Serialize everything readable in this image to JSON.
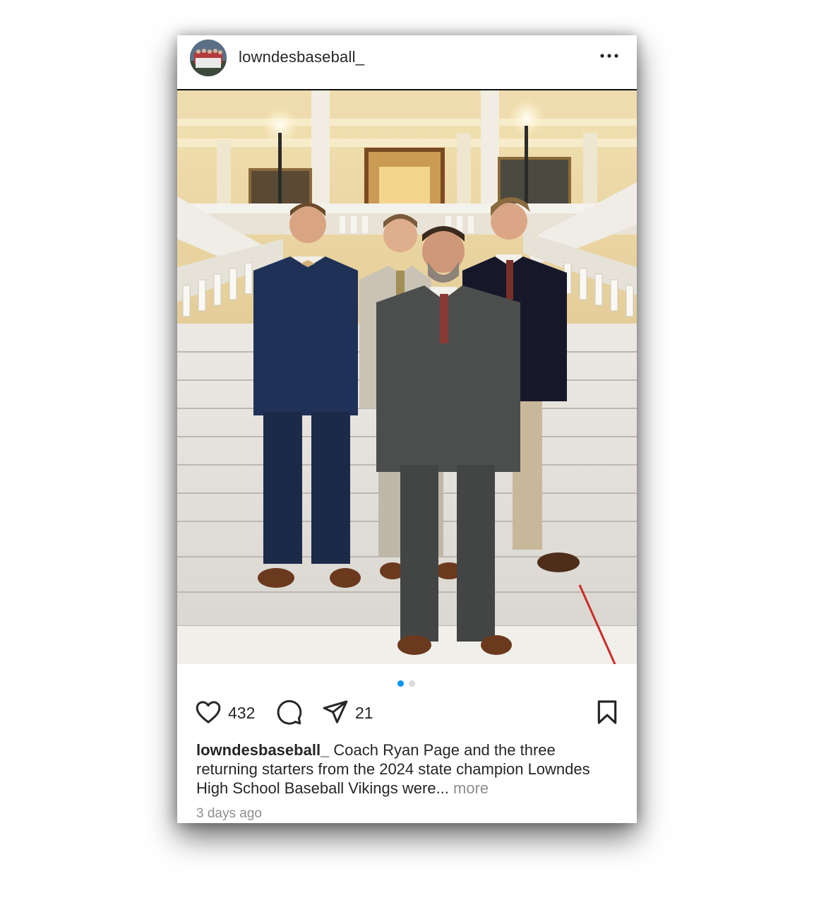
{
  "post": {
    "username": "lowndesbaseball_",
    "likes": "432",
    "shares": "21",
    "caption_user": "lowndesbaseball_",
    "caption_text": " Coach Ryan Page and the three returning starters from the 2024 state champion Lowndes High School Baseball Vikings were",
    "caption_ellipsis": "... ",
    "more_label": "more",
    "timestamp": "3 days ago"
  },
  "carousel": {
    "current": 1,
    "total": 2
  },
  "icons": {
    "menu": "more-horizontal-icon",
    "like": "heart-icon",
    "comment": "comment-icon",
    "share": "paper-plane-icon",
    "save": "bookmark-icon"
  },
  "colors": {
    "text": "#262626",
    "muted": "#8e8e8e",
    "active_dot": "#0095f6",
    "inactive_dot": "#dbdbdb"
  }
}
